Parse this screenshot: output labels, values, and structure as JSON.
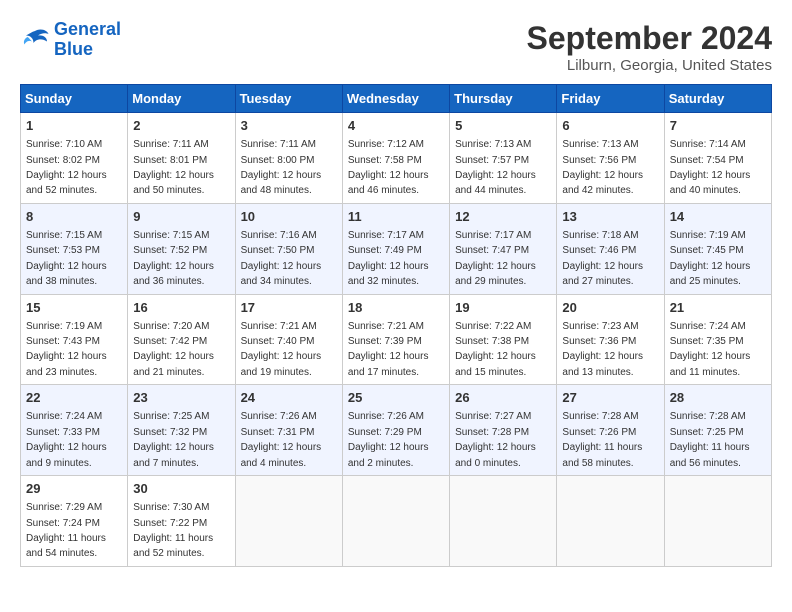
{
  "header": {
    "logo_line1": "General",
    "logo_line2": "Blue",
    "month_title": "September 2024",
    "location": "Lilburn, Georgia, United States"
  },
  "columns": [
    "Sunday",
    "Monday",
    "Tuesday",
    "Wednesday",
    "Thursday",
    "Friday",
    "Saturday"
  ],
  "weeks": [
    [
      {
        "day": "1",
        "info": "Sunrise: 7:10 AM\nSunset: 8:02 PM\nDaylight: 12 hours\nand 52 minutes."
      },
      {
        "day": "2",
        "info": "Sunrise: 7:11 AM\nSunset: 8:01 PM\nDaylight: 12 hours\nand 50 minutes."
      },
      {
        "day": "3",
        "info": "Sunrise: 7:11 AM\nSunset: 8:00 PM\nDaylight: 12 hours\nand 48 minutes."
      },
      {
        "day": "4",
        "info": "Sunrise: 7:12 AM\nSunset: 7:58 PM\nDaylight: 12 hours\nand 46 minutes."
      },
      {
        "day": "5",
        "info": "Sunrise: 7:13 AM\nSunset: 7:57 PM\nDaylight: 12 hours\nand 44 minutes."
      },
      {
        "day": "6",
        "info": "Sunrise: 7:13 AM\nSunset: 7:56 PM\nDaylight: 12 hours\nand 42 minutes."
      },
      {
        "day": "7",
        "info": "Sunrise: 7:14 AM\nSunset: 7:54 PM\nDaylight: 12 hours\nand 40 minutes."
      }
    ],
    [
      {
        "day": "8",
        "info": "Sunrise: 7:15 AM\nSunset: 7:53 PM\nDaylight: 12 hours\nand 38 minutes."
      },
      {
        "day": "9",
        "info": "Sunrise: 7:15 AM\nSunset: 7:52 PM\nDaylight: 12 hours\nand 36 minutes."
      },
      {
        "day": "10",
        "info": "Sunrise: 7:16 AM\nSunset: 7:50 PM\nDaylight: 12 hours\nand 34 minutes."
      },
      {
        "day": "11",
        "info": "Sunrise: 7:17 AM\nSunset: 7:49 PM\nDaylight: 12 hours\nand 32 minutes."
      },
      {
        "day": "12",
        "info": "Sunrise: 7:17 AM\nSunset: 7:47 PM\nDaylight: 12 hours\nand 29 minutes."
      },
      {
        "day": "13",
        "info": "Sunrise: 7:18 AM\nSunset: 7:46 PM\nDaylight: 12 hours\nand 27 minutes."
      },
      {
        "day": "14",
        "info": "Sunrise: 7:19 AM\nSunset: 7:45 PM\nDaylight: 12 hours\nand 25 minutes."
      }
    ],
    [
      {
        "day": "15",
        "info": "Sunrise: 7:19 AM\nSunset: 7:43 PM\nDaylight: 12 hours\nand 23 minutes."
      },
      {
        "day": "16",
        "info": "Sunrise: 7:20 AM\nSunset: 7:42 PM\nDaylight: 12 hours\nand 21 minutes."
      },
      {
        "day": "17",
        "info": "Sunrise: 7:21 AM\nSunset: 7:40 PM\nDaylight: 12 hours\nand 19 minutes."
      },
      {
        "day": "18",
        "info": "Sunrise: 7:21 AM\nSunset: 7:39 PM\nDaylight: 12 hours\nand 17 minutes."
      },
      {
        "day": "19",
        "info": "Sunrise: 7:22 AM\nSunset: 7:38 PM\nDaylight: 12 hours\nand 15 minutes."
      },
      {
        "day": "20",
        "info": "Sunrise: 7:23 AM\nSunset: 7:36 PM\nDaylight: 12 hours\nand 13 minutes."
      },
      {
        "day": "21",
        "info": "Sunrise: 7:24 AM\nSunset: 7:35 PM\nDaylight: 12 hours\nand 11 minutes."
      }
    ],
    [
      {
        "day": "22",
        "info": "Sunrise: 7:24 AM\nSunset: 7:33 PM\nDaylight: 12 hours\nand 9 minutes."
      },
      {
        "day": "23",
        "info": "Sunrise: 7:25 AM\nSunset: 7:32 PM\nDaylight: 12 hours\nand 7 minutes."
      },
      {
        "day": "24",
        "info": "Sunrise: 7:26 AM\nSunset: 7:31 PM\nDaylight: 12 hours\nand 4 minutes."
      },
      {
        "day": "25",
        "info": "Sunrise: 7:26 AM\nSunset: 7:29 PM\nDaylight: 12 hours\nand 2 minutes."
      },
      {
        "day": "26",
        "info": "Sunrise: 7:27 AM\nSunset: 7:28 PM\nDaylight: 12 hours\nand 0 minutes."
      },
      {
        "day": "27",
        "info": "Sunrise: 7:28 AM\nSunset: 7:26 PM\nDaylight: 11 hours\nand 58 minutes."
      },
      {
        "day": "28",
        "info": "Sunrise: 7:28 AM\nSunset: 7:25 PM\nDaylight: 11 hours\nand 56 minutes."
      }
    ],
    [
      {
        "day": "29",
        "info": "Sunrise: 7:29 AM\nSunset: 7:24 PM\nDaylight: 11 hours\nand 54 minutes."
      },
      {
        "day": "30",
        "info": "Sunrise: 7:30 AM\nSunset: 7:22 PM\nDaylight: 11 hours\nand 52 minutes."
      },
      {
        "day": "",
        "info": ""
      },
      {
        "day": "",
        "info": ""
      },
      {
        "day": "",
        "info": ""
      },
      {
        "day": "",
        "info": ""
      },
      {
        "day": "",
        "info": ""
      }
    ]
  ]
}
